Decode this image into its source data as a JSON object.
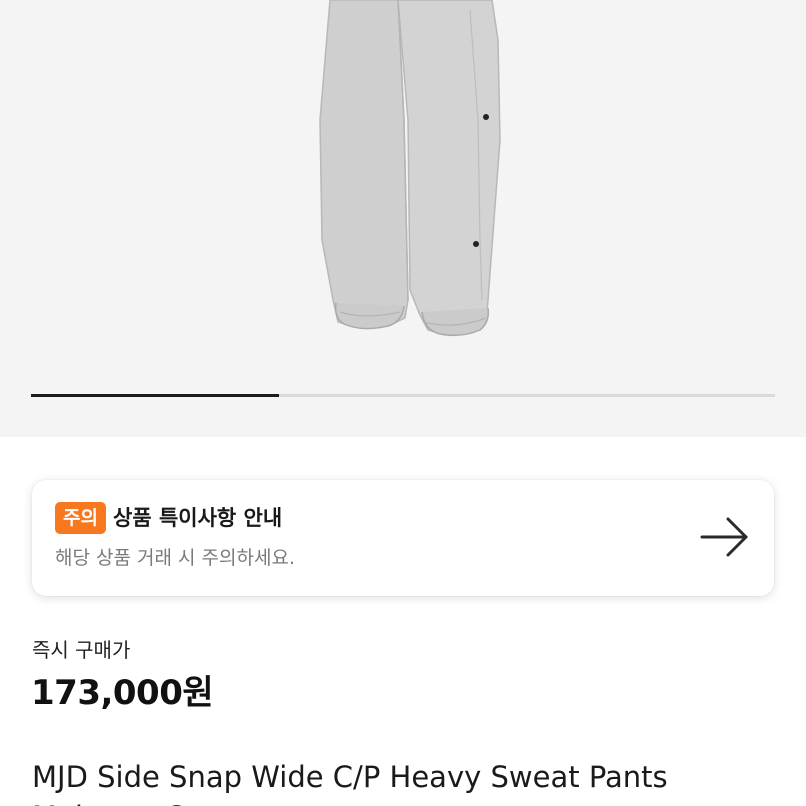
{
  "product_image": {
    "alt": "grey sweat pants"
  },
  "carousel": {
    "progress": 0.333
  },
  "notice": {
    "badge": "주의",
    "title": "상품 특이사항 안내",
    "subtitle": "해당 상품 거래 시 주의하세요.",
    "arrow_icon": "arrow-right-icon",
    "badge_color": "#f7781e"
  },
  "price": {
    "label": "즉시 구매가",
    "value": "173,000원"
  },
  "product": {
    "name": "MJD Side Snap Wide C/P Heavy Sweat Pants Melange Grey"
  }
}
